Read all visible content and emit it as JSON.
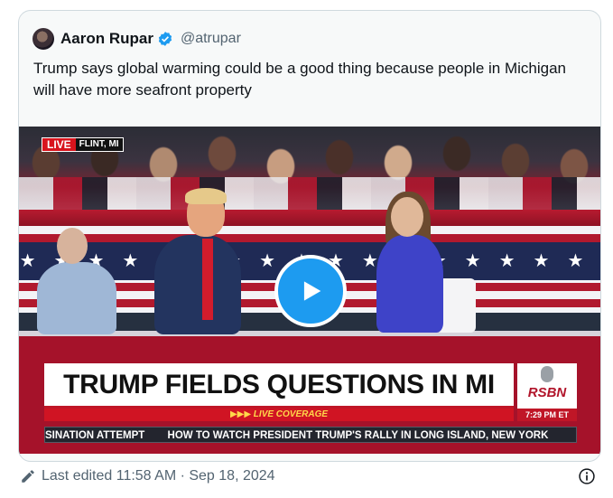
{
  "tweet": {
    "author_name": "Aaron Rupar",
    "handle": "@atrupar",
    "text": "Trump says global warming could be a good thing because people in Michigan will have more seafront property"
  },
  "video": {
    "live_label": "LIVE",
    "location": "FLINT, MI",
    "chyron_title": "TRUMP FIELDS QUESTIONS IN MI",
    "live_coverage": "▶▶▶ LIVE COVERAGE",
    "network": "RSBN",
    "time": "7:29 PM ET",
    "ticker_items": [
      "SINATION ATTEMPT",
      "HOW TO WATCH PRESIDENT TRUMP'S RALLY IN LONG ISLAND, NEW YORK"
    ]
  },
  "footer": {
    "edited": "Last edited 11:58 AM · Sep 18, 2024"
  },
  "colors": {
    "accent": "#1d9bf0",
    "muted_text": "#536471"
  },
  "icons": [
    "avatar",
    "verified-badge-icon",
    "play-icon",
    "pencil-icon",
    "info-icon"
  ]
}
